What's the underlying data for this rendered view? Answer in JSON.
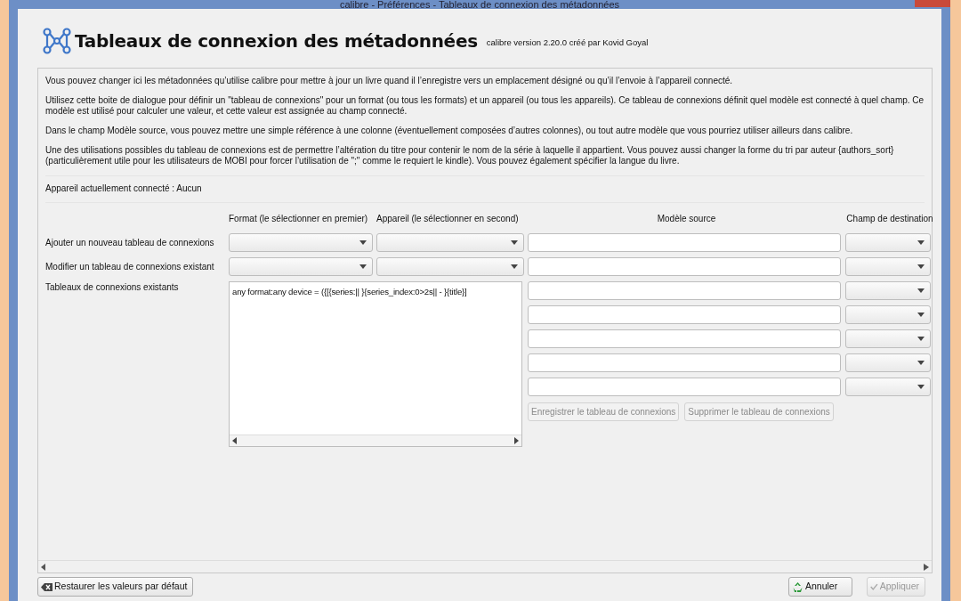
{
  "window": {
    "title": "calibre - Préférences - Tableaux de connexion des métadonnées"
  },
  "header": {
    "title": "Tableaux de connexion des métadonnées",
    "version": "calibre version 2.20.0 créé par Kovid Goyal"
  },
  "description": [
    "Vous pouvez changer ici les métadonnées qu’utilise calibre pour mettre à jour un livre quand il l’enregistre vers un emplacement désigné ou qu’il l’envoie à l’appareil connecté.",
    "Utilisez cette boite de dialogue pour définir un \"tableau de connexions\" pour un format (ou tous les formats) et un appareil (ou tous les appareils). Ce tableau de connexions définit quel modèle est connecté à quel champ. Ce modèle est utilisé pour calculer une valeur, et cette valeur est assignée au champ connecté.",
    "Dans le champ Modèle source, vous pouvez mettre une simple référence à une colonne (éventuellement composées d’autres colonnes), ou tout autre modèle que vous pourriez utiliser ailleurs dans calibre.",
    "Une des utilisations possibles du tableau de connexions est de permettre l’altération du titre pour contenir le nom de la série à laquelle il appartient. Vous pouvez aussi changer la forme du tri par auteur {authors_sort} (particulièrement utile pour les utilisateurs de MOBI pour forcer l’utilisation de \";\" comme le requiert le kindle). Vous pouvez également spécifier la langue du livre."
  ],
  "connected_device": "Appareil actuellement connecté : Aucun",
  "columns": [
    "Format (le sélectionner en premier)",
    "Appareil (le sélectionner en second)",
    "Modèle source",
    "Champ de destination"
  ],
  "add_row": {
    "label": "Ajouter un nouveau tableau de connexions"
  },
  "edit_row": {
    "label": "Modifier un tableau de connexions existant"
  },
  "existing": {
    "label": "Tableaux de connexions existants",
    "items": [
      "any format:any device = ({[{series:|| }{series_index:0>2s|| - }{title}]"
    ]
  },
  "extra_rows": [
    {
      "kind": "pair"
    },
    {
      "kind": "pair"
    },
    {
      "kind": "pair"
    },
    {
      "kind": "pair"
    },
    {
      "kind": "pair"
    }
  ],
  "actions": [
    {
      "label": "Enregistrer le tableau de connexions",
      "disabled": true
    },
    {
      "label": "Supprimer le tableau de connexions",
      "disabled": true
    }
  ],
  "footer": {
    "restore": {
      "label": "Restaurer les valeurs par défaut"
    },
    "buttons": [
      {
        "kind": "cancel",
        "label": "Annuler",
        "disabled": false
      },
      {
        "kind": "apply",
        "label": "Appliquer",
        "disabled": true
      }
    ]
  }
}
